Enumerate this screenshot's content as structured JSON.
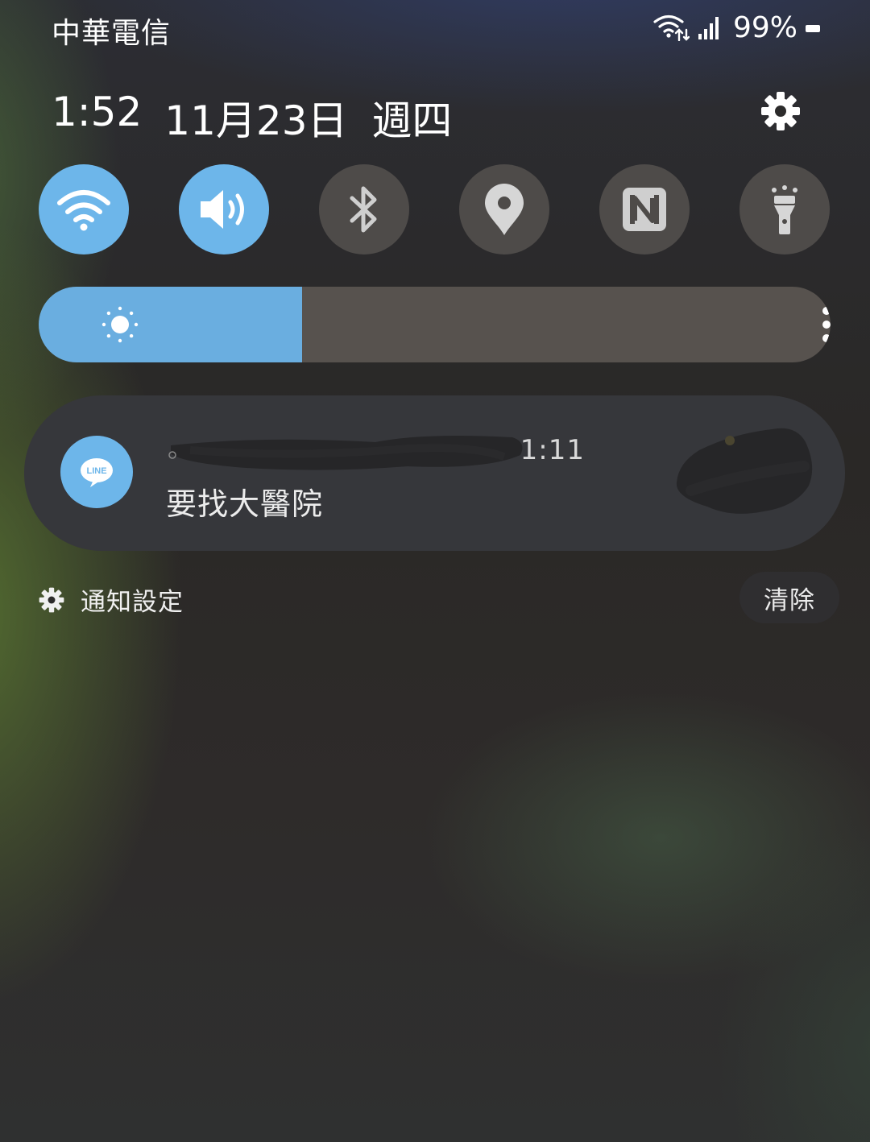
{
  "status_bar": {
    "carrier": "中華電信",
    "battery": "99%",
    "icons": [
      "wifi-data-icon",
      "signal-icon",
      "battery-icon"
    ]
  },
  "header": {
    "time": "1:52",
    "date": "11月23日",
    "weekday": "週四",
    "settings_icon": "gear-icon"
  },
  "quick_settings": [
    {
      "icon": "wifi-icon",
      "state": "on"
    },
    {
      "icon": "sound-icon",
      "state": "on"
    },
    {
      "icon": "bluetooth-icon",
      "state": "off"
    },
    {
      "icon": "location-icon",
      "state": "off"
    },
    {
      "icon": "nfc-icon",
      "state": "off"
    },
    {
      "icon": "flashlight-icon",
      "state": "off"
    }
  ],
  "brightness": {
    "level": 0.333,
    "icon": "sun-icon",
    "more_icon": "more-vertical-icon"
  },
  "notification": {
    "app_icon": "line-icon",
    "app_icon_text": "LINE",
    "time": "1:11",
    "message": "要找大醫院"
  },
  "footer": {
    "settings_label": "通知設定",
    "clear_label": "清除"
  },
  "colors": {
    "tile_on": "#6db6ea",
    "tile_off": "#4e4b49",
    "brightness_fill": "#6aaee0",
    "card": "#36373b"
  }
}
